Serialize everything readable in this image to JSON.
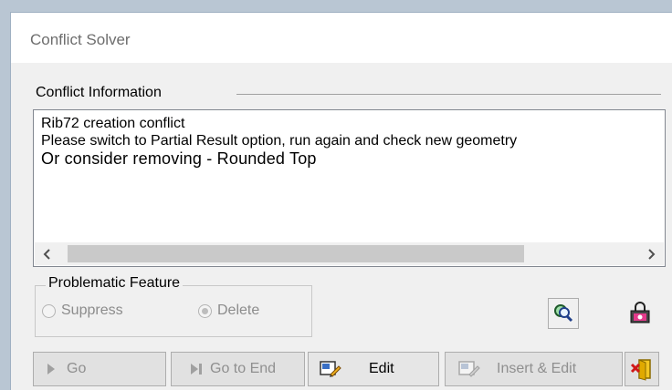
{
  "window": {
    "title": "Conflict Solver"
  },
  "conflict_info": {
    "group_label": "Conflict Information",
    "lines": [
      "Rib72 creation conflict",
      "Please switch to Partial Result option, run again and check new geometry",
      "Or consider removing - Rounded Top"
    ],
    "scroll_left": "<",
    "scroll_right": ">"
  },
  "problematic_feature": {
    "label": "Problematic Feature",
    "options": [
      {
        "label": "Suppress",
        "selected": false,
        "enabled": false
      },
      {
        "label": "Delete",
        "selected": true,
        "enabled": false
      }
    ]
  },
  "buttons": {
    "go": "Go",
    "go_to_end": "Go to End",
    "edit": "Edit",
    "insert_edit": "Insert & Edit"
  },
  "icons": {
    "reframe": "reframe-geometry-icon",
    "capture": "camera-lock-icon",
    "go": "play-arrow-icon",
    "go_to_end": "skip-to-end-icon",
    "edit": "edit-feature-icon",
    "insert_edit": "insert-edit-icon",
    "exit": "exit-door-icon"
  }
}
